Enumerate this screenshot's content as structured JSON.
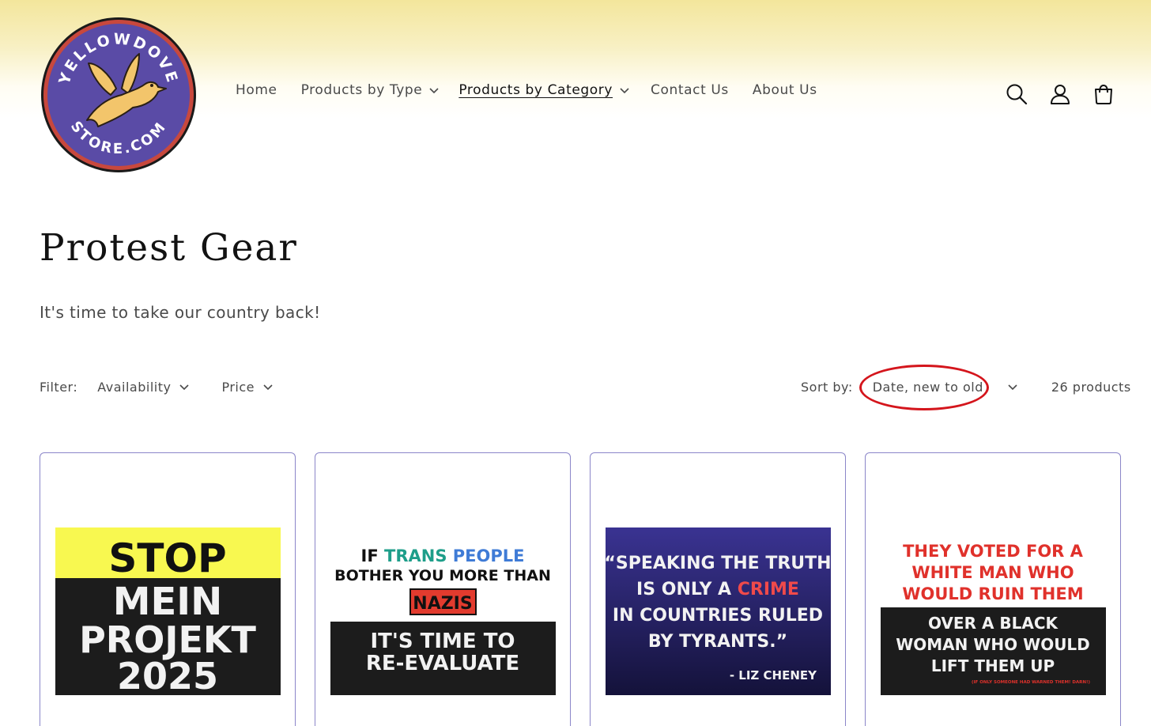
{
  "colors": {
    "accent_underline": "#121212",
    "text_muted": "#4a4a4a",
    "card_border": "#8b86c9",
    "highlight_red": "#d4151c",
    "logo_purple": "#5a4ba6",
    "logo_ring_red": "#c8483d",
    "logo_dove": "#f3c56b"
  },
  "logo": {
    "top_text": "YELLOWDOVE",
    "bottom_text": "STORE.COM"
  },
  "nav": {
    "items": [
      {
        "label": "Home",
        "has_dropdown": false
      },
      {
        "label": "Products by Type",
        "has_dropdown": true
      },
      {
        "label": "Products by Category",
        "has_dropdown": true,
        "active": true
      },
      {
        "label": "Contact Us",
        "has_dropdown": false
      },
      {
        "label": "About Us",
        "has_dropdown": false
      }
    ]
  },
  "header_icons": [
    "search-icon",
    "account-icon",
    "cart-icon"
  ],
  "page": {
    "title": "Protest Gear",
    "subtitle": "It's time to take our country back!"
  },
  "filters": {
    "label": "Filter:",
    "availability": "Availability",
    "price": "Price"
  },
  "sort": {
    "label": "Sort by:",
    "value": "Date, new to old",
    "count": "26 products"
  },
  "products": [
    {
      "poster": {
        "line1": "STOP",
        "line2": "MEIN",
        "line3": "PROJEKT",
        "line4": "2025"
      }
    },
    {
      "poster": {
        "if": "IF",
        "trans": "TRANS",
        "people": "PEOPLE",
        "line2": "BOTHER YOU MORE THAN",
        "nazis": "NAZIS",
        "line4": "IT'S TIME TO",
        "line5": "RE-EVALUATE"
      }
    },
    {
      "poster": {
        "line1": "“SPEAKING THE TRUTH",
        "line2a": "IS ONLY A",
        "crime": "CRIME",
        "line3": "IN COUNTRIES RULED",
        "line4": "BY TYRANTS.”",
        "attribution": "- LIZ CHENEY"
      }
    },
    {
      "poster": {
        "line1": "THEY VOTED FOR A",
        "line2": "WHITE MAN WHO",
        "line3": "WOULD RUIN THEM",
        "line4": "OVER A BLACK",
        "line5": "WOMAN WHO WOULD",
        "line6": "LIFT THEM UP",
        "footnote": "(IF ONLY SOMEONE HAD WARNED THEM! DARN!)"
      }
    }
  ]
}
